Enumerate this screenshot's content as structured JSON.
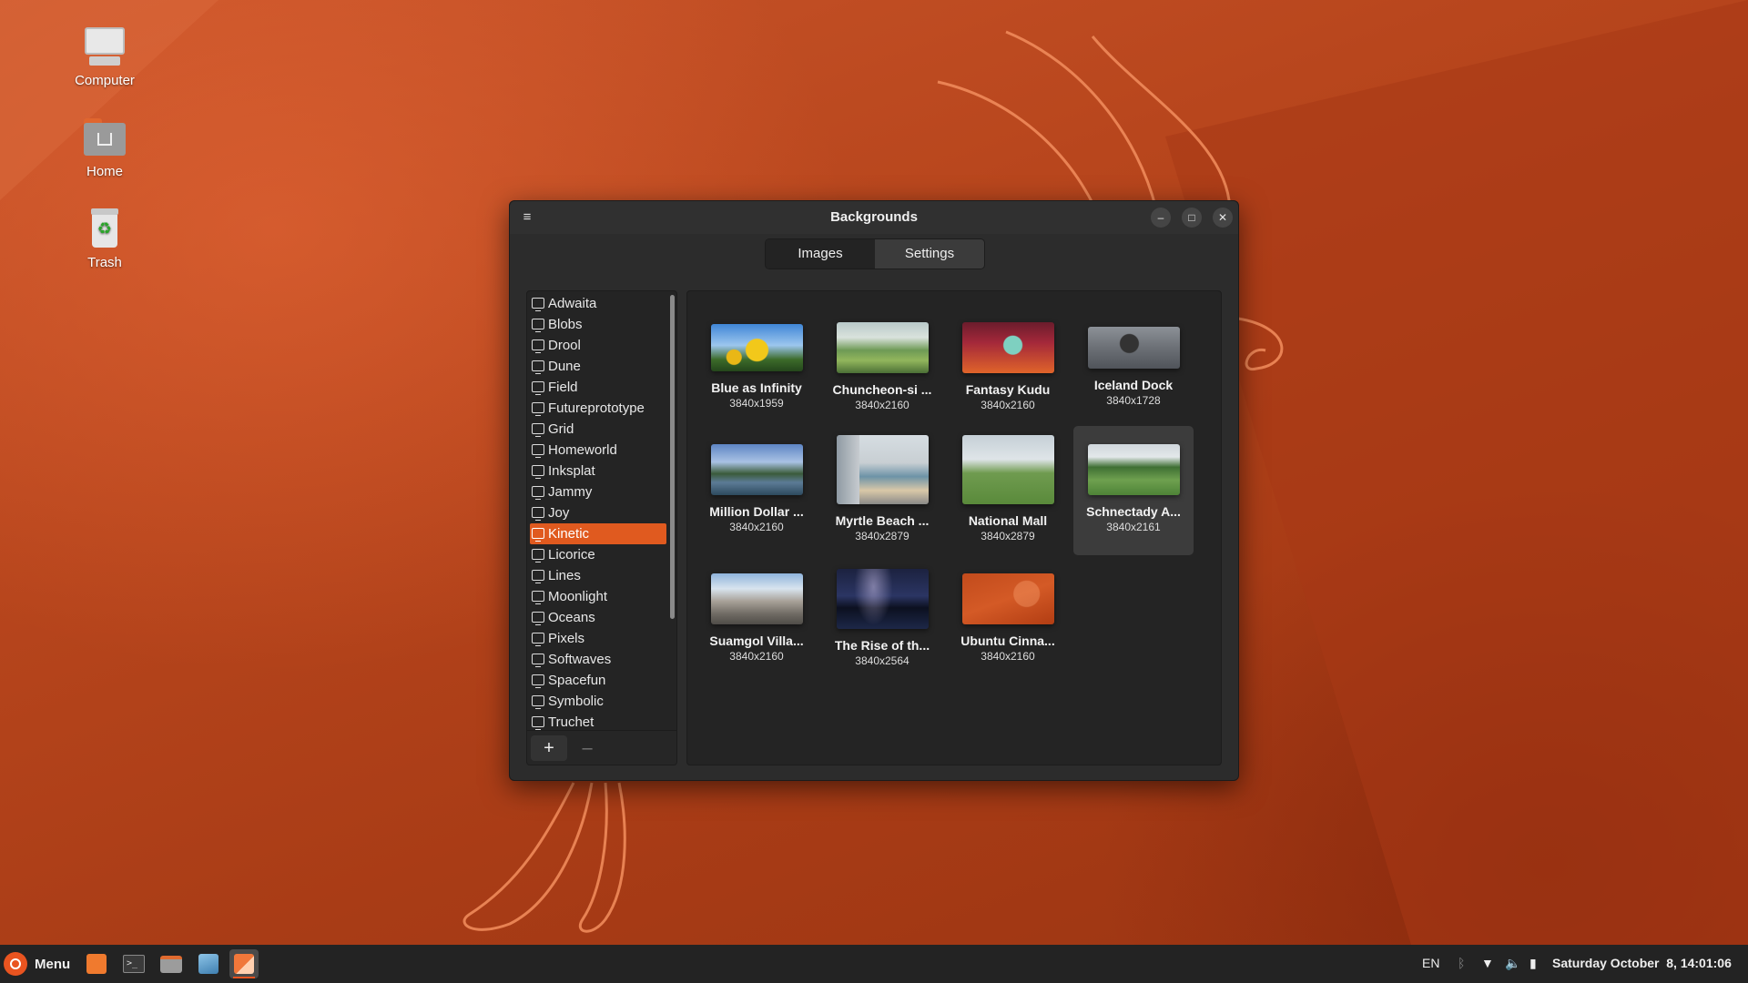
{
  "desktop": {
    "icons": [
      {
        "label": "Computer",
        "icon": "computer-icon"
      },
      {
        "label": "Home",
        "icon": "home-folder-icon"
      },
      {
        "label": "Trash",
        "icon": "trash-icon"
      }
    ]
  },
  "window": {
    "title": "Backgrounds",
    "menu_icon": "hamburger-menu-icon",
    "controls": {
      "minimize": "–",
      "maximize": "□",
      "close": "✕"
    },
    "tabs": [
      {
        "label": "Images",
        "active": true
      },
      {
        "label": "Settings",
        "active": false
      }
    ],
    "sidebar": {
      "items": [
        {
          "label": "Adwaita"
        },
        {
          "label": "Blobs"
        },
        {
          "label": "Drool"
        },
        {
          "label": "Dune"
        },
        {
          "label": "Field"
        },
        {
          "label": "Futureprototype"
        },
        {
          "label": "Grid"
        },
        {
          "label": "Homeworld"
        },
        {
          "label": "Inksplat"
        },
        {
          "label": "Jammy"
        },
        {
          "label": "Joy"
        },
        {
          "label": "Kinetic",
          "selected": true
        },
        {
          "label": "Licorice"
        },
        {
          "label": "Lines"
        },
        {
          "label": "Moonlight"
        },
        {
          "label": "Oceans"
        },
        {
          "label": "Pixels"
        },
        {
          "label": "Softwaves"
        },
        {
          "label": "Spacefun"
        },
        {
          "label": "Symbolic"
        },
        {
          "label": "Truchet"
        }
      ],
      "add_label": "+",
      "remove_label": "–"
    },
    "images": [
      {
        "name": "Blue as Infinity",
        "size": "3840x1959",
        "theme": "sunflower"
      },
      {
        "name": "Chuncheon-si ...",
        "size": "3840x2160",
        "theme": "hills"
      },
      {
        "name": "Fantasy Kudu",
        "size": "3840x2160",
        "theme": "kudu"
      },
      {
        "name": "Iceland Dock",
        "size": "3840x1728",
        "theme": "dock"
      },
      {
        "name": "Million Dollar ...",
        "size": "3840x2160",
        "theme": "lake"
      },
      {
        "name": "Myrtle Beach ...",
        "size": "3840x2879",
        "theme": "beach"
      },
      {
        "name": "National Mall",
        "size": "3840x2879",
        "theme": "lawn"
      },
      {
        "name": "Schnectady A...",
        "size": "3840x2161",
        "theme": "field",
        "selected": true
      },
      {
        "name": "Suamgol Villa...",
        "size": "3840x2160",
        "theme": "village"
      },
      {
        "name": "The Rise of th...",
        "size": "3840x2564",
        "theme": "milkyway"
      },
      {
        "name": "Ubuntu Cinna...",
        "size": "3840x2160",
        "theme": "ubuntu"
      }
    ]
  },
  "taskbar": {
    "menu_label": "Menu",
    "apps": [
      {
        "name": "orange-app-icon"
      },
      {
        "name": "terminal-icon"
      },
      {
        "name": "files-icon"
      },
      {
        "name": "image-viewer-icon"
      },
      {
        "name": "backgrounds-app-icon",
        "active": true
      }
    ],
    "language": "EN",
    "clock": "Saturday October  8, 14:01:06"
  }
}
